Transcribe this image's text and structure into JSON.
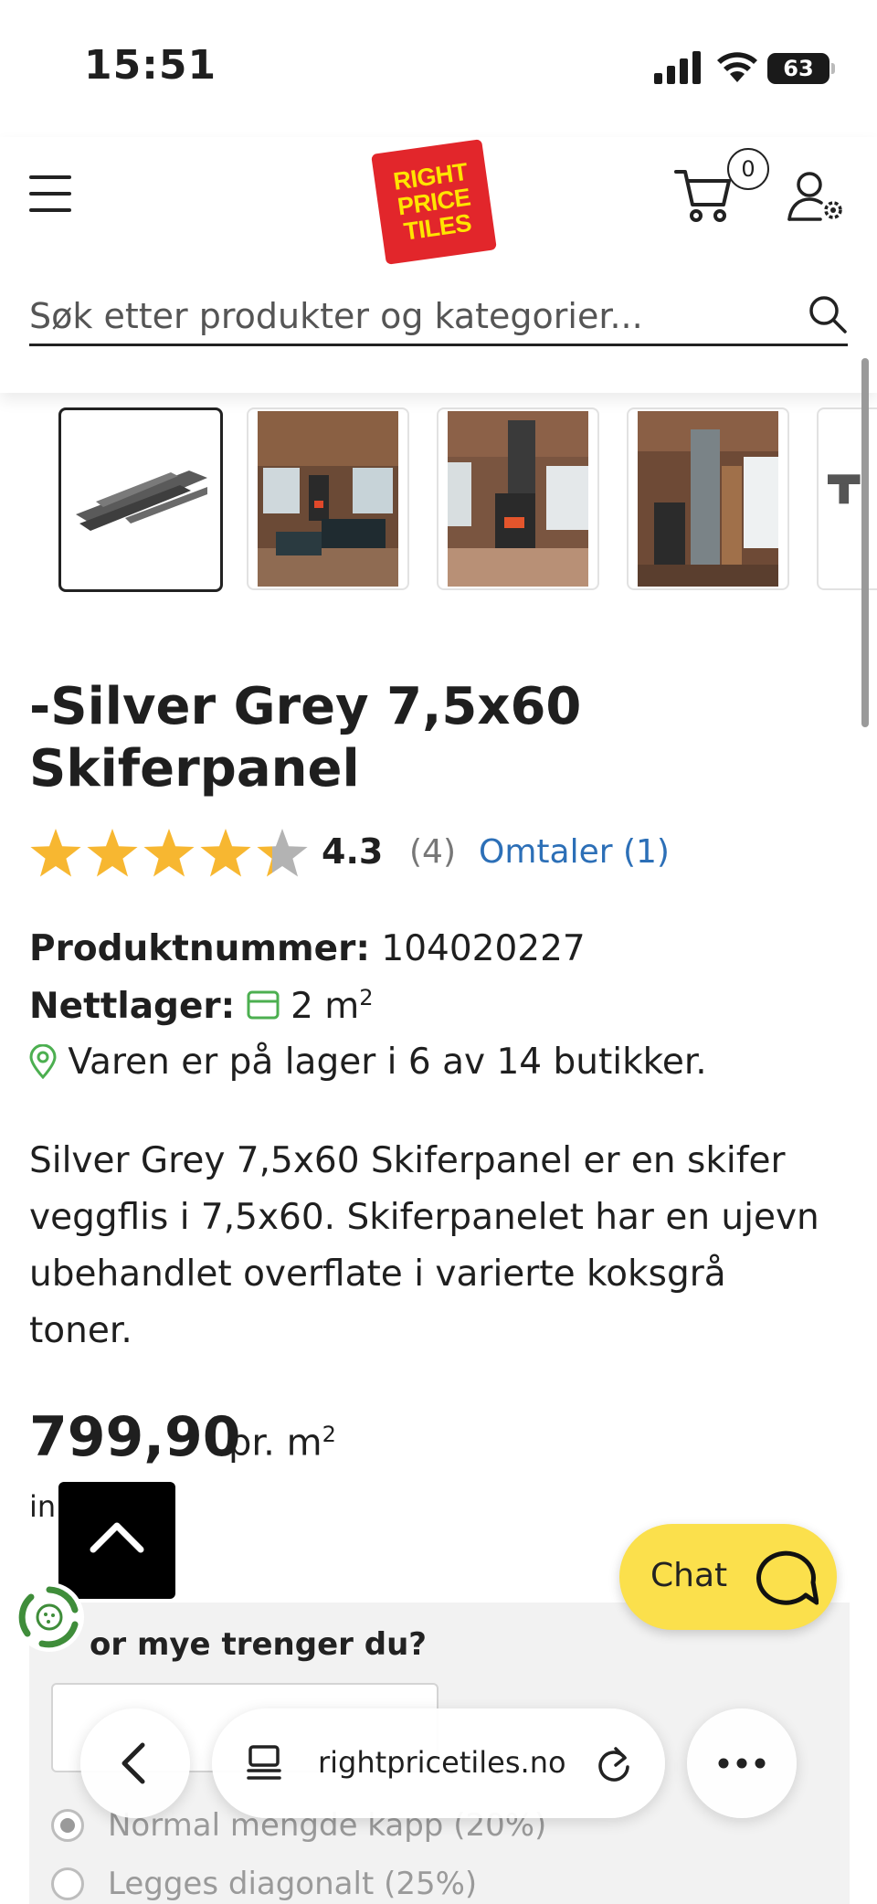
{
  "status_bar": {
    "time": "15:51",
    "battery": "63"
  },
  "header": {
    "logo_lines": [
      "RIGHT",
      "PRICE",
      "TILES"
    ],
    "cart_count": "0",
    "search_placeholder": "Søk etter produkter og kategorier..."
  },
  "gallery": {
    "thumbnails": [
      "slate-panel-product",
      "living-room-fireplace",
      "fireplace-wall",
      "stove-corner",
      "panel-detail"
    ]
  },
  "product": {
    "title_line1": "-Silver Grey 7,5x60",
    "title_line2": "Skiferpanel",
    "rating": {
      "value": "4.3",
      "stars_fraction": 0.86,
      "count": "(4)",
      "reviews_link": "Omtaler (1)"
    },
    "product_number_label": "Produktnummer:",
    "product_number": "104020227",
    "online_stock_label": "Nettlager:",
    "online_stock_value": "2 m",
    "online_stock_sup": "2",
    "store_stock": "Varen er på lager i 6 av 14 butikker.",
    "description": "Silver Grey 7,5x60 Skiferpanel er en skifer veggflis i 7,5x60. Skiferpanelet har en ujevn ubehandlet overflate i varierte koksgrå toner.",
    "price": "799,90",
    "price_unit": "pr. m",
    "price_unit_sup": "2",
    "incl_text": "in"
  },
  "chat": {
    "label": "Chat"
  },
  "calculator": {
    "title": "or mye trenger du?",
    "options": [
      {
        "label": "Normal mengde kapp (20%)",
        "checked": true
      },
      {
        "label": "Legges diagonalt (25%)",
        "checked": false
      }
    ]
  },
  "browser": {
    "url": "rightpricetiles.no"
  }
}
